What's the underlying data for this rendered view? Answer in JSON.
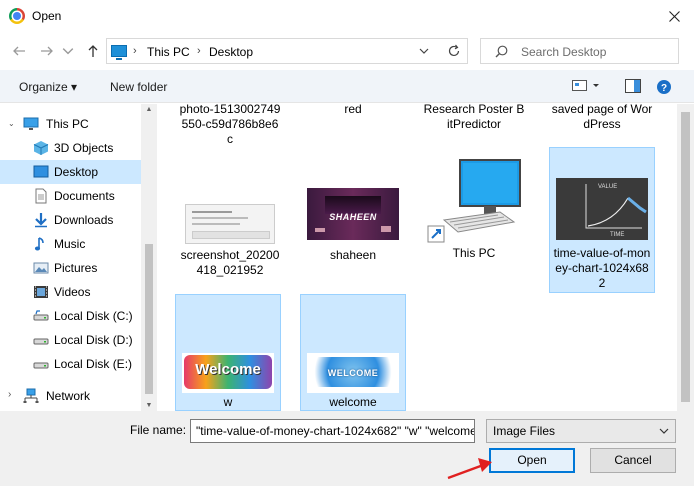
{
  "window": {
    "title": "Open"
  },
  "address": {
    "crumbs": [
      "This PC",
      "Desktop"
    ]
  },
  "search": {
    "placeholder": "Search Desktop"
  },
  "toolbar": {
    "organize": "Organize",
    "new_folder": "New folder"
  },
  "sidebar": {
    "items": [
      {
        "label": "This PC",
        "icon": "pc-icon"
      },
      {
        "label": "3D Objects",
        "icon": "3d-objects-icon"
      },
      {
        "label": "Desktop",
        "icon": "desktop-icon",
        "selected": true
      },
      {
        "label": "Documents",
        "icon": "documents-icon"
      },
      {
        "label": "Downloads",
        "icon": "downloads-icon"
      },
      {
        "label": "Music",
        "icon": "music-icon"
      },
      {
        "label": "Pictures",
        "icon": "pictures-icon"
      },
      {
        "label": "Videos",
        "icon": "videos-icon"
      },
      {
        "label": "Local Disk (C:)",
        "icon": "drive-icon"
      },
      {
        "label": "Local Disk (D:)",
        "icon": "drive-icon"
      },
      {
        "label": "Local Disk (E:)",
        "icon": "drive-icon"
      },
      {
        "label": "Network",
        "icon": "network-icon"
      }
    ]
  },
  "files": {
    "row0": [
      "photo-1513002749550-c59d786b8e6c",
      "red",
      "Research Poster BitPredictor",
      "saved page of WordPress"
    ],
    "row1": [
      "screenshot_20200418_021952",
      "shaheen",
      "This PC",
      "time-value-of-money-chart-1024x682"
    ],
    "row2": [
      "w",
      "welcome"
    ],
    "shaheen_thumb_text": "SHAHEEN",
    "chart_thumb_value": "VALUE",
    "chart_thumb_time": "TIME",
    "welcome_text_1": "Welcome",
    "welcome_text_2": "WELCOME"
  },
  "bottom": {
    "file_name_label": "File name:",
    "file_name_value": "\"time-value-of-money-chart-1024x682\" \"w\" \"welcome\"",
    "file_type": "Image Files",
    "open": "Open",
    "cancel": "Cancel"
  },
  "colors": {
    "selection": "#cce8ff",
    "accent": "#0078d7",
    "annotation": "#e02020"
  }
}
